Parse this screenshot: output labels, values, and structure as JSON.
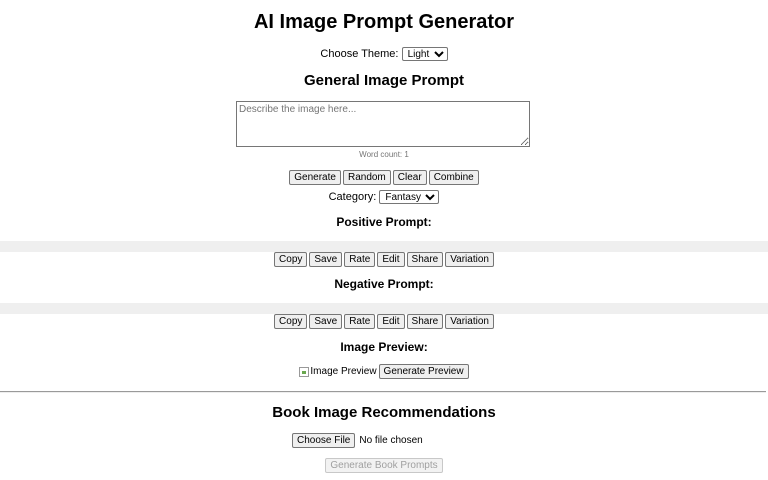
{
  "page": {
    "title": "AI Image Prompt Generator"
  },
  "theme": {
    "label": "Choose Theme:",
    "selected": "Light"
  },
  "general": {
    "heading": "General Image Prompt",
    "placeholder": "Describe the image here...",
    "word_count": "Word count: 1",
    "buttons": [
      "Generate",
      "Random",
      "Clear",
      "Combine"
    ]
  },
  "category": {
    "label": "Category:",
    "selected": "Fantasy"
  },
  "positive": {
    "heading": "Positive Prompt:",
    "buttons": [
      "Copy",
      "Save",
      "Rate",
      "Edit",
      "Share",
      "Variation"
    ]
  },
  "negative": {
    "heading": "Negative Prompt:",
    "buttons": [
      "Copy",
      "Save",
      "Rate",
      "Edit",
      "Share",
      "Variation"
    ]
  },
  "preview": {
    "heading": "Image Preview:",
    "alt_text": "Image Preview",
    "button": "Generate Preview"
  },
  "book": {
    "heading": "Book Image Recommendations",
    "choose_file": "Choose File",
    "no_file": "No file chosen",
    "generate_button": "Generate Book Prompts"
  }
}
